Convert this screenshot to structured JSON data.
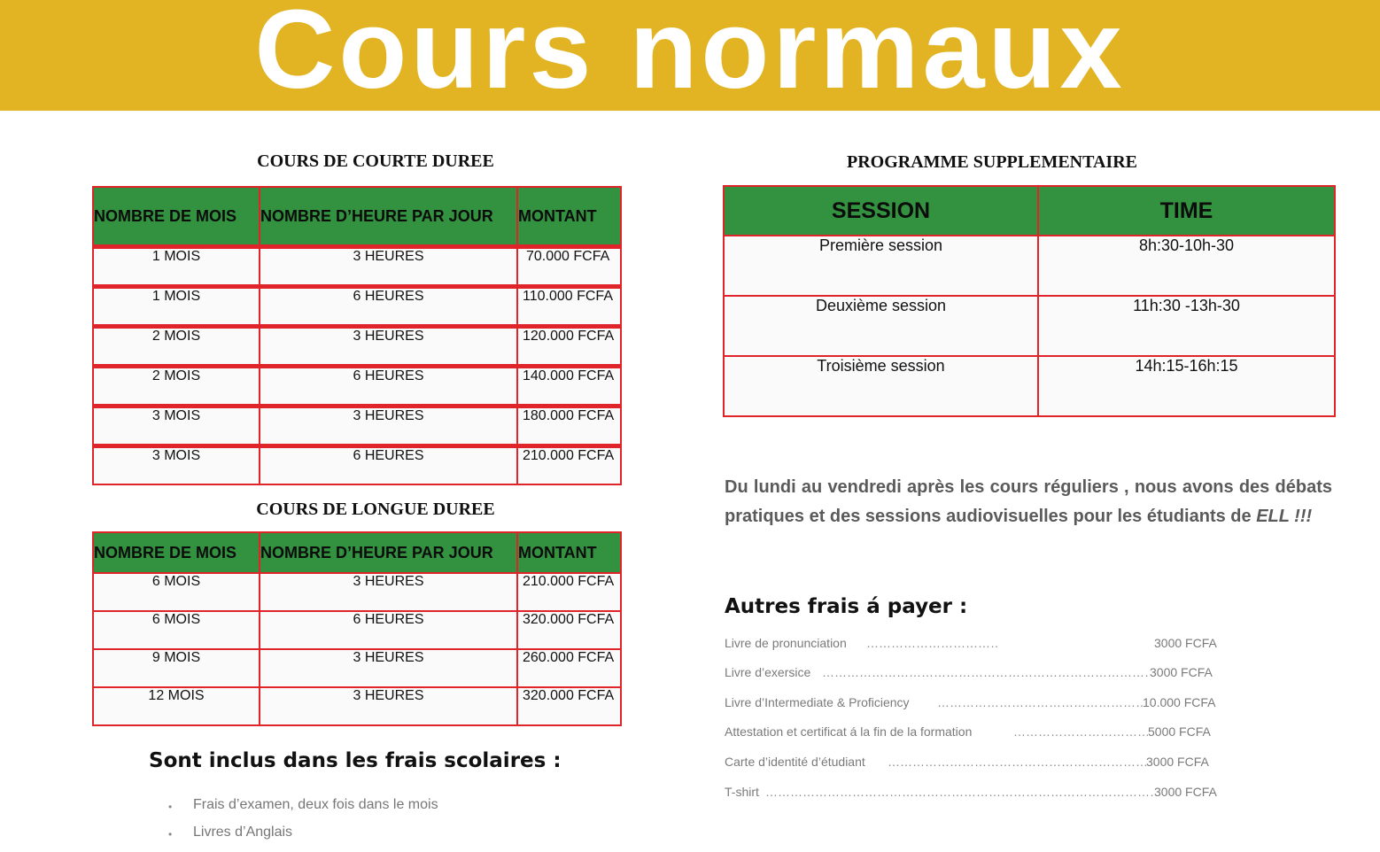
{
  "banner": {
    "title": "Cours normaux",
    "color": "#E2B322"
  },
  "short_courses": {
    "title": "COURS DE COURTE DUREE",
    "headers": [
      "NOMBRE DE MOIS",
      "NOMBRE D’HEURE PAR JOUR",
      "MONTANT"
    ],
    "rows": [
      [
        "1 MOIS",
        "3 HEURES",
        "70.000 FCFA"
      ],
      [
        "1 MOIS",
        "6 HEURES",
        "110.000 FCFA"
      ],
      [
        "2 MOIS",
        "3 HEURES",
        "120.000 FCFA"
      ],
      [
        "2 MOIS",
        "6 HEURES",
        "140.000 FCFA"
      ],
      [
        "3 MOIS",
        "3 HEURES",
        "180.000 FCFA"
      ],
      [
        "3 MOIS",
        "6 HEURES",
        "210.000 FCFA"
      ]
    ]
  },
  "long_courses": {
    "title": "COURS DE LONGUE DUREE",
    "headers": [
      "NOMBRE DE MOIS",
      "NOMBRE D’HEURE PAR JOUR",
      "MONTANT"
    ],
    "rows": [
      [
        "6 MOIS",
        "3 HEURES",
        "210.000 FCFA"
      ],
      [
        "6 MOIS",
        "6 HEURES",
        "320.000 FCFA"
      ],
      [
        "9 MOIS",
        "3 HEURES",
        "260.000 FCFA"
      ],
      [
        "12 MOIS",
        "3 HEURES",
        "320.000 FCFA"
      ]
    ]
  },
  "included": {
    "heading": "Sont inclus dans les frais scolaires :",
    "items": [
      "Frais d’examen, deux fois dans le mois",
      "Livres d’Anglais"
    ]
  },
  "supplementary": {
    "title": "PROGRAMME SUPPLEMENTAIRE",
    "headers": [
      "SESSION",
      "TIME"
    ],
    "rows": [
      [
        "Première session",
        "8h:30-10h-30"
      ],
      [
        "Deuxième session",
        "11h:30 -13h-30"
      ],
      [
        "Troisième session",
        "14h:15-16h:15"
      ]
    ]
  },
  "description": {
    "text": "Du lundi au vendredi   après  les cours réguliers , nous avons des débats  pratiques  et  des  sessions  audiovisuelles  pour  les  étudiants  de ",
    "emphasis": "ELL !!!"
  },
  "other_fees": {
    "heading": "Autres frais á payer :",
    "items": [
      {
        "label": "Livre de pronunciation",
        "price": "3000 FCFA"
      },
      {
        "label": "Livre d’exersice",
        "price": "3000 FCFA"
      },
      {
        "label": "Livre d’Intermediate & Proficiency",
        "price": "10.000 FCFA"
      },
      {
        "label": "Attestation et certificat á la fin de la formation",
        "price": "5000 FCFA"
      },
      {
        "label": "Carte d’identité d’étudiant",
        "price": "3000 FCFA"
      },
      {
        "label": "T-shirt",
        "price": "3000 FCFA"
      }
    ]
  },
  "colors": {
    "header_green": "#33923F",
    "border_red": "#E0252A",
    "cell_bg": "#FBFAFB"
  }
}
